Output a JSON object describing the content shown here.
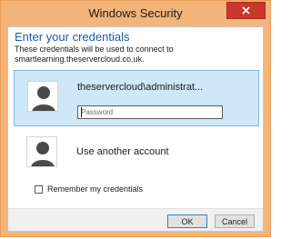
{
  "window": {
    "title": "Windows Security",
    "accent_color": "#f3b47a",
    "close_icon": "close-icon"
  },
  "dialog": {
    "heading": "Enter your credentials",
    "description": "These credentials will be used to connect to smartlearning.theservercloud.co.uk."
  },
  "accounts": {
    "selected": {
      "name": "theservercloud\\administrat...",
      "password_placeholder": "Password",
      "password_value": "",
      "avatar_icon": "user-avatar-icon"
    },
    "other": {
      "label": "Use another account",
      "avatar_icon": "user-avatar-icon"
    }
  },
  "remember": {
    "label": "Remember my credentials",
    "checked": false
  },
  "buttons": {
    "ok": "OK",
    "cancel": "Cancel"
  }
}
